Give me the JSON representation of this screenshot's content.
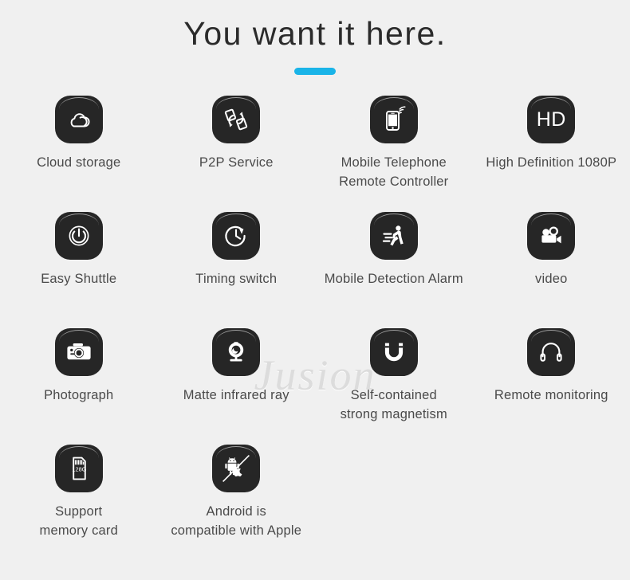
{
  "header": {
    "title": "You want it here.",
    "accent_color": "#1ab4e8"
  },
  "watermark": {
    "text": "Jusion"
  },
  "theme": {
    "background": "#f0f0f0",
    "tile_color": "#262626",
    "label_color": "#4a4a4a",
    "glyph_color": "#ffffff"
  },
  "features": [
    {
      "icon": "cloud-icon",
      "label": "Cloud storage"
    },
    {
      "icon": "p2p-sync-icon",
      "label": "P2P Service"
    },
    {
      "icon": "mobile-phone-wifi-icon",
      "label": "Mobile Telephone\nRemote Controller"
    },
    {
      "icon": "hd-badge-icon",
      "label": "High Definition 1080P",
      "hd_text": "HD"
    },
    {
      "icon": "power-button-icon",
      "label": "Easy Shuttle"
    },
    {
      "icon": "clock-timer-icon",
      "label": "Timing switch"
    },
    {
      "icon": "running-person-icon",
      "label": "Mobile Detection Alarm"
    },
    {
      "icon": "movie-camera-icon",
      "label": "video"
    },
    {
      "icon": "photo-camera-icon",
      "label": "Photograph"
    },
    {
      "icon": "webcam-icon",
      "label": "Matte infrared ray"
    },
    {
      "icon": "magnet-icon",
      "label": "Self-contained\nstrong magnetism"
    },
    {
      "icon": "headphones-icon",
      "label": "Remote monitoring"
    },
    {
      "icon": "memory-card-icon",
      "label": "Support\nmemory card",
      "card_text": "128G"
    },
    {
      "icon": "android-apple-icon",
      "label": "Android is\ncompatible  with Apple"
    }
  ]
}
